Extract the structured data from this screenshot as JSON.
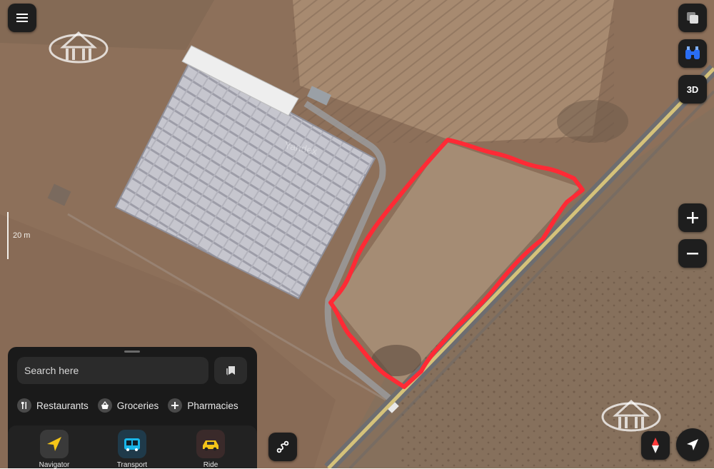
{
  "map": {
    "scale_label": "20 m",
    "watermark_text": "Yandex",
    "route_color": "#ff2a35"
  },
  "controls": {
    "menu_icon": "hamburger-menu-icon",
    "layers_icon": "layers-icon",
    "panorama_icon": "panorama-binoculars-icon",
    "three_d_label": "3D",
    "zoom_in_icon": "plus-icon",
    "zoom_out_icon": "minus-icon",
    "compass_icon": "compass-icon",
    "location_icon": "location-arrow-icon",
    "ruler_icon": "route-ruler-icon"
  },
  "panel": {
    "search_placeholder": "Search here",
    "bookmarks_icon": "bookmarks-icon",
    "chips": [
      {
        "label": "Restaurants",
        "icon": "fork-knife-icon"
      },
      {
        "label": "Groceries",
        "icon": "basket-icon"
      },
      {
        "label": "Pharmacies",
        "icon": "cross-icon"
      }
    ],
    "nav": [
      {
        "label": "Navigator",
        "icon": "navigator-arrow-icon"
      },
      {
        "label": "Transport",
        "icon": "bus-icon"
      },
      {
        "label": "Ride",
        "icon": "taxi-icon"
      }
    ]
  },
  "colors": {
    "accent_blue": "#2a6df4",
    "taxi_yellow": "#f5c518",
    "dark_ui": "#1e1e1e"
  }
}
